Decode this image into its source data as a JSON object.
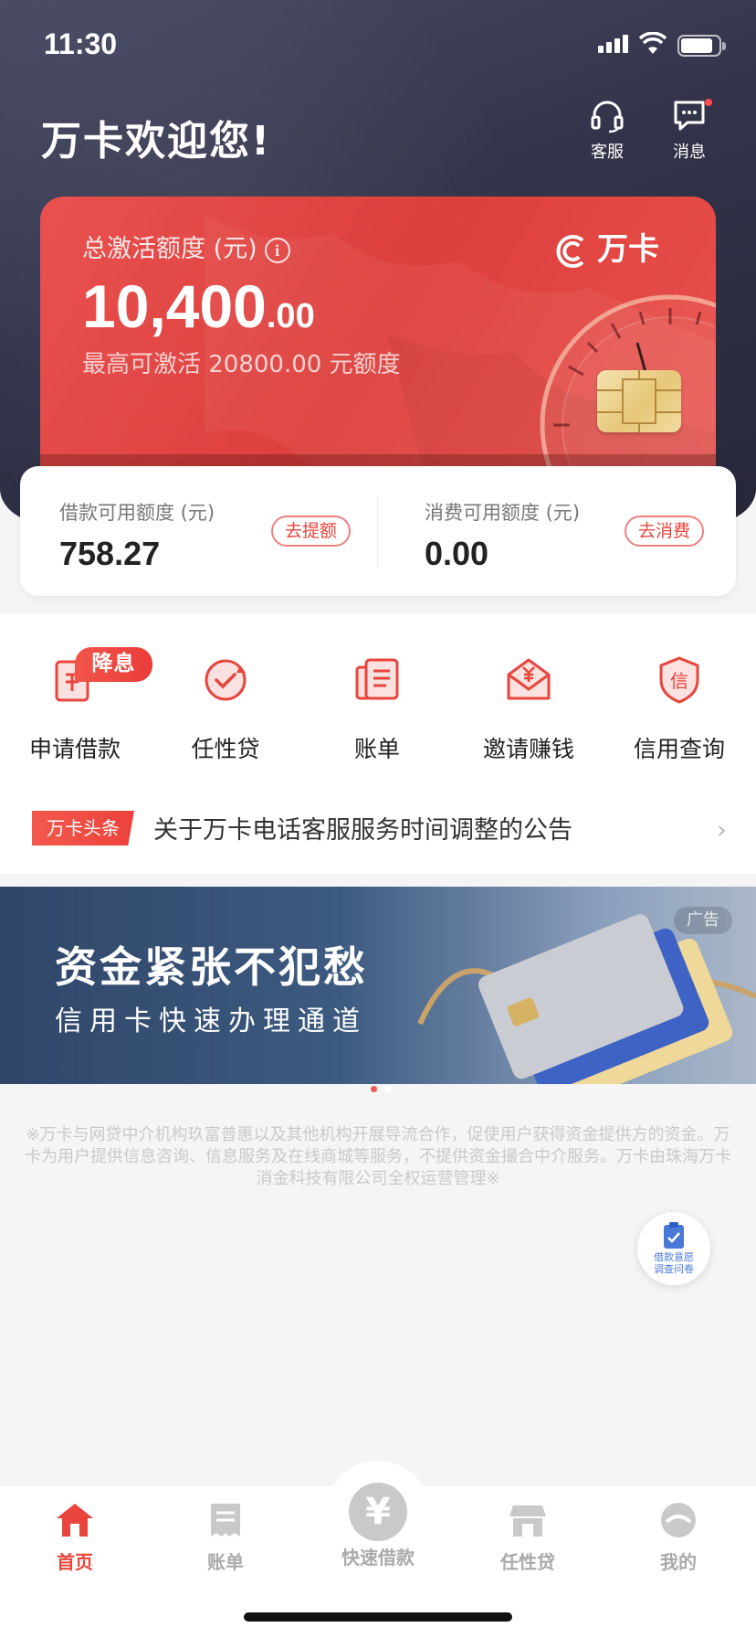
{
  "status_bar": {
    "time": "11:30"
  },
  "header": {
    "welcome": "万卡欢迎您!",
    "service_label": "客服",
    "message_label": "消息"
  },
  "credit_card": {
    "title": "总激活额度 (元)",
    "amount_int": "10,400",
    "amount_dec": ".00",
    "subtitle": "最高可激活 20800.00 元额度",
    "brand": "万卡"
  },
  "limits": {
    "loan": {
      "label": "借款可用额度 (元)",
      "value": "758.27",
      "action": "去提额"
    },
    "consume": {
      "label": "消费可用额度 (元)",
      "value": "0.00",
      "action": "去消费"
    }
  },
  "shortcuts": [
    {
      "label": "申请借款",
      "icon": "loan-document-icon",
      "badge": "降息"
    },
    {
      "label": "任性贷",
      "icon": "refresh-check-icon"
    },
    {
      "label": "账单",
      "icon": "bill-icon"
    },
    {
      "label": "邀请赚钱",
      "icon": "yuan-envelope-icon"
    },
    {
      "label": "信用查询",
      "icon": "credit-shield-icon"
    }
  ],
  "notice": {
    "tag": "万卡头条",
    "text": "关于万卡电话客服服务时间调整的公告"
  },
  "banner": {
    "headline": "资金紧张不犯愁",
    "subline": "信用卡快速办理通道",
    "ad_label": "广告",
    "slide_count": 2,
    "active_slide": 1
  },
  "disclaimer": "※万卡与网贷中介机构玖富普惠以及其他机构开展导流合作，促使用户获得资金提供方的资金。万卡为用户提供信息咨询、信息服务及在线商城等服务，不提供资金撮合中介服务。万卡由珠海万卡消金科技有限公司全权运营管理※",
  "survey": {
    "line1": "借款意愿",
    "line2": "调查问卷"
  },
  "tabbar": {
    "home": "首页",
    "bill": "账单",
    "quick_loan": "快速借款",
    "quick_loan_symbol": "¥",
    "renxing": "任性贷",
    "mine": "我的"
  },
  "colors": {
    "accent": "#e8453c",
    "hero_dark": "#2f3045",
    "inactive": "#aaaaaa"
  }
}
